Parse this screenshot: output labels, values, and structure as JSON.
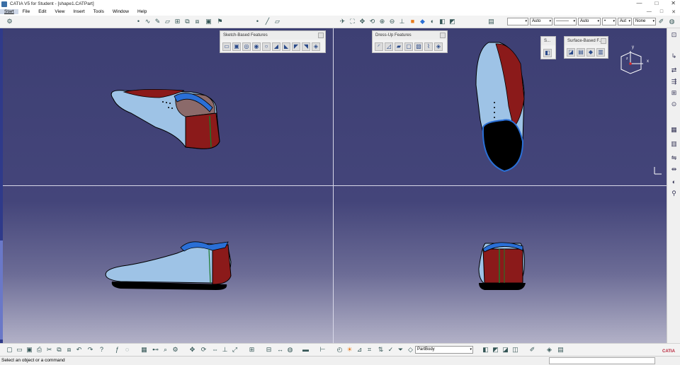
{
  "window": {
    "title": "CATIA V5 for Student - [shape1.CATPart]",
    "controls": [
      "—",
      "□",
      "✕"
    ],
    "doc_controls": [
      "—",
      "□",
      "✕"
    ]
  },
  "menu": {
    "items": [
      "Start",
      "File",
      "Edit",
      "View",
      "Insert",
      "Tools",
      "Window",
      "Help"
    ]
  },
  "toolbar": {
    "line_color": "",
    "line_weight": "Auto",
    "line_type": "———",
    "line_style": "Auto",
    "point": "•",
    "layer_label": "Aut",
    "layer": "None"
  },
  "palettes": {
    "sketch_based": {
      "title": "Sketch-Based Features"
    },
    "dress_up": {
      "title": "Dress-Up Features"
    },
    "small": {
      "title": "S..."
    },
    "surface_based": {
      "title": "Surface-Based F..."
    }
  },
  "compass": {
    "x": "x",
    "y": "y",
    "z": "z"
  },
  "part_body": {
    "value": "PartBody"
  },
  "status": {
    "text": "Select an object or a command"
  },
  "logo": {
    "text": "CATIA"
  },
  "colors": {
    "viewport_top": "#3d3f73",
    "viewport_bottom": "#b2b1c7",
    "shoe_body": "#9ec3e6",
    "shoe_red": "#8b1a1a",
    "shoe_blue": "#2a6fd6"
  }
}
